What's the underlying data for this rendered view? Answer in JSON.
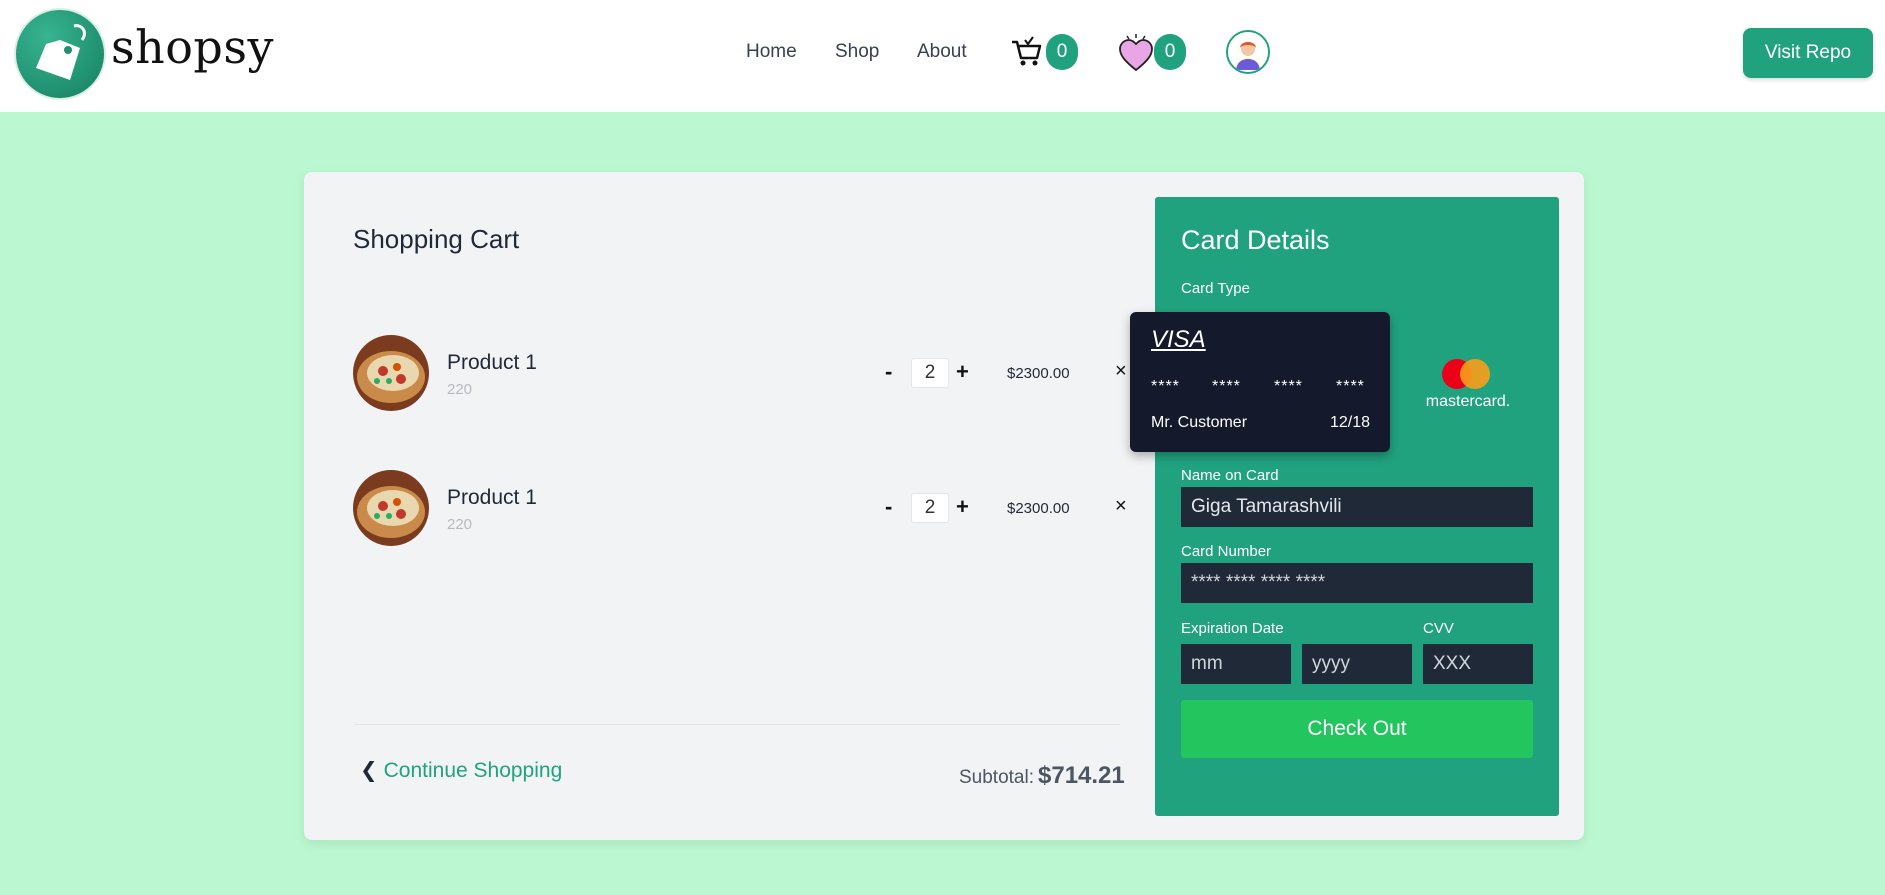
{
  "header": {
    "brand": "shopsy",
    "nav": {
      "home": "Home",
      "shop": "Shop",
      "about": "About"
    },
    "cart_count": "0",
    "wishlist_count": "0",
    "visit_repo": "Visit Repo"
  },
  "cart": {
    "title": "Shopping Cart",
    "items": [
      {
        "name": "Product 1",
        "sub": "220",
        "quantity": "2",
        "price": "$2300.00",
        "minus": "-",
        "plus": "+",
        "remove": "×"
      },
      {
        "name": "Product 1",
        "sub": "220",
        "quantity": "2",
        "price": "$2300.00",
        "minus": "-",
        "plus": "+",
        "remove": "×"
      }
    ],
    "continue_label": "Continue Shopping",
    "continue_chevron": "❮",
    "subtotal_label": "Subtotal:",
    "subtotal_value": "$714.21"
  },
  "card_details": {
    "title": "Card Details",
    "card_type_label": "Card Type",
    "visa": {
      "logo": "VISA",
      "groups": [
        "****",
        "****",
        "****",
        "****"
      ],
      "holder": "Mr. Customer",
      "expiry": "12/18"
    },
    "mastercard_label": "mastercard.",
    "name_label": "Name on Card",
    "name_value": "Giga Tamarashvili",
    "number_label": "Card Number",
    "number_placeholder": "**** **** **** ****",
    "expiry_label": "Expiration Date",
    "month_placeholder": "mm",
    "year_placeholder": "yyyy",
    "cvv_label": "CVV",
    "cvv_placeholder": "XXX",
    "checkout_label": "Check Out"
  },
  "colors": {
    "accent": "#21a27f",
    "page_bg": "#bbf7d0",
    "checkout": "#22c55e",
    "dark_input": "#1f2937"
  }
}
